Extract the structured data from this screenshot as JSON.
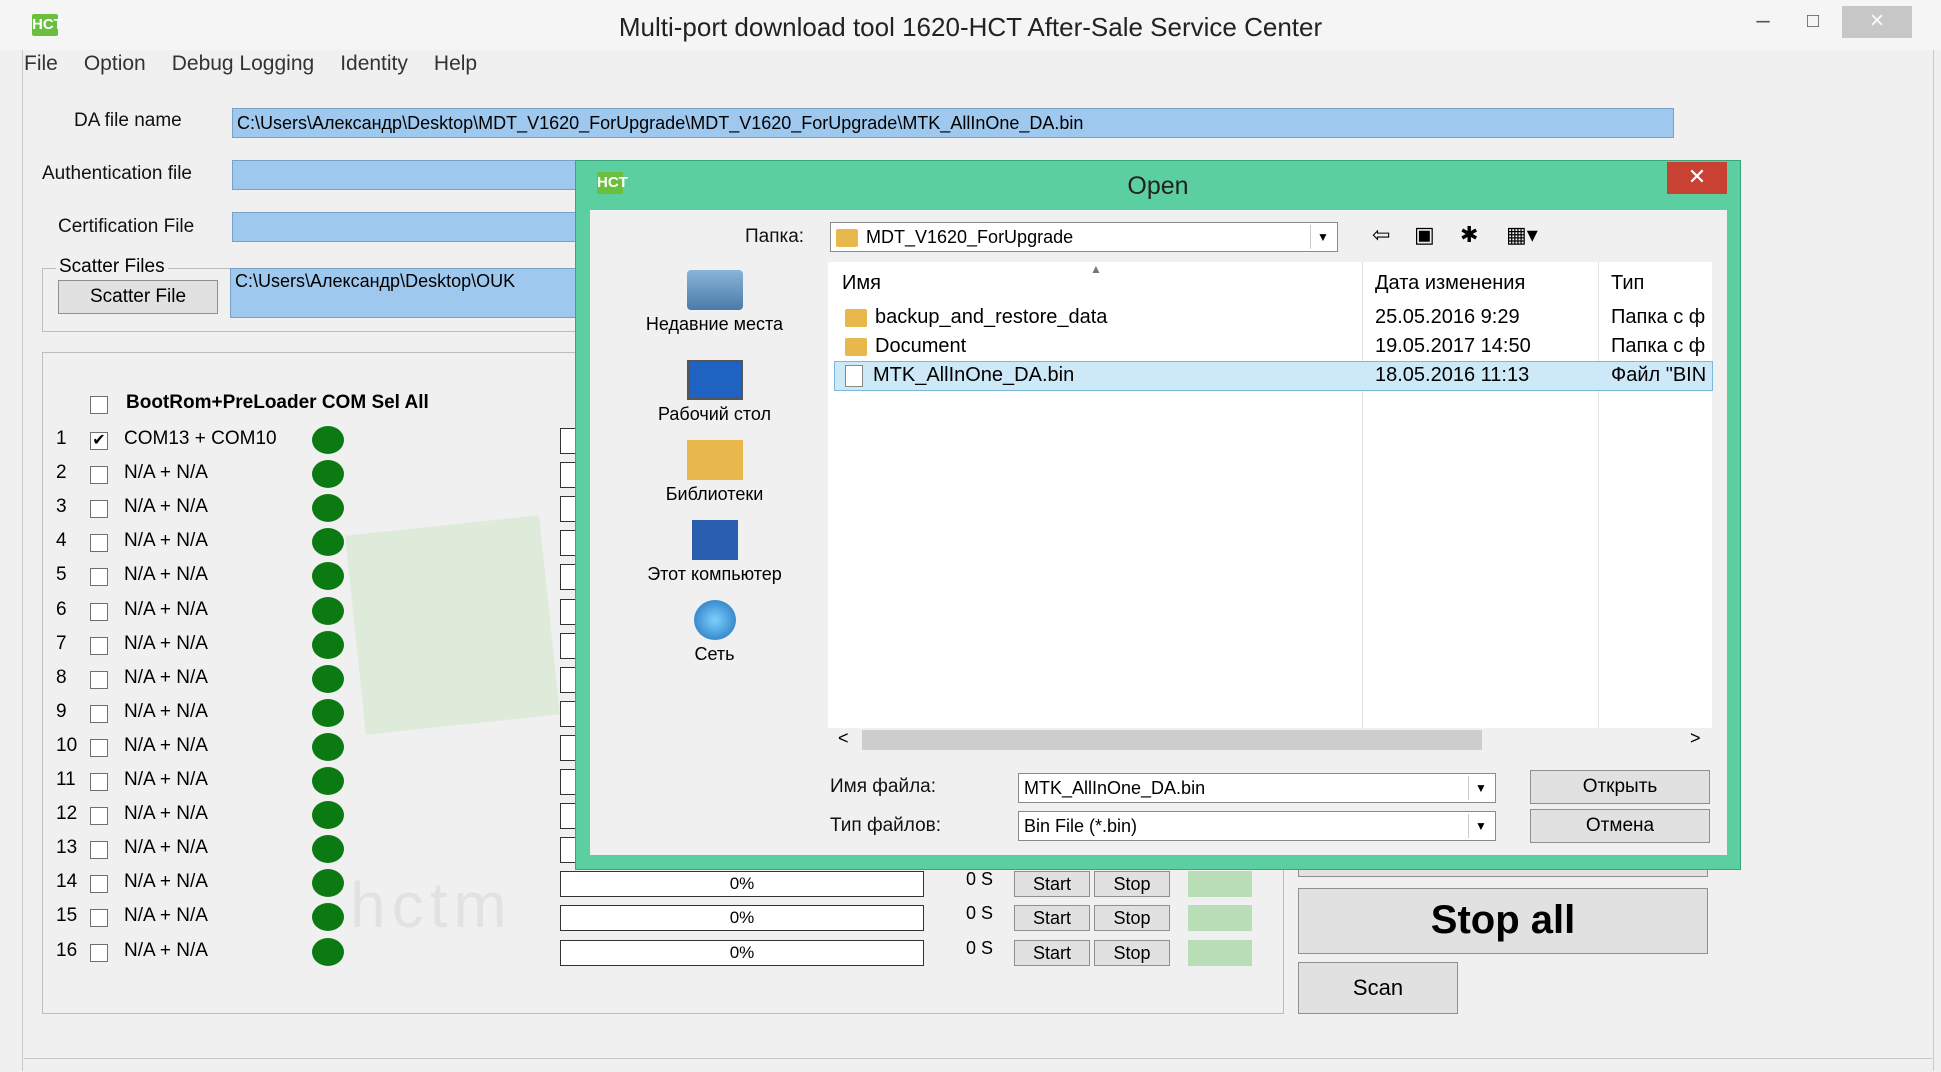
{
  "window": {
    "title": "Multi-port download tool 1620-HCT After-Sale Service Center",
    "icon_text": "HCT",
    "controls": [
      "–",
      "□",
      "×"
    ]
  },
  "menu": [
    "File",
    "Option",
    "Debug Logging",
    "Identity",
    "Help"
  ],
  "form": {
    "da_label": "DA file name",
    "da_value": "C:\\Users\\Александр\\Desktop\\MDT_V1620_ForUpgrade\\MDT_V1620_ForUpgrade\\MTK_AllInOne_DA.bin",
    "auth_label": "Authentication file",
    "auth_value": "",
    "cert_label": "Certification File",
    "cert_value": "",
    "scatter_group": "Scatter Files",
    "scatter_button": "Scatter File",
    "scatter_value": "C:\\Users\\Александр\\Desktop\\OUK"
  },
  "ports": {
    "select_all_label": "BootRom+PreLoader COM Sel All",
    "rows": [
      {
        "num": "1",
        "name": "COM13 + COM10",
        "checked": true
      },
      {
        "num": "2",
        "name": "N/A + N/A",
        "checked": false
      },
      {
        "num": "3",
        "name": "N/A + N/A",
        "checked": false
      },
      {
        "num": "4",
        "name": "N/A + N/A",
        "checked": false
      },
      {
        "num": "5",
        "name": "N/A + N/A",
        "checked": false
      },
      {
        "num": "6",
        "name": "N/A + N/A",
        "checked": false
      },
      {
        "num": "7",
        "name": "N/A + N/A",
        "checked": false
      },
      {
        "num": "8",
        "name": "N/A + N/A",
        "checked": false
      },
      {
        "num": "9",
        "name": "N/A + N/A",
        "checked": false
      },
      {
        "num": "10",
        "name": "N/A + N/A",
        "checked": false
      },
      {
        "num": "11",
        "name": "N/A + N/A",
        "checked": false
      },
      {
        "num": "12",
        "name": "N/A + N/A",
        "checked": false
      },
      {
        "num": "13",
        "name": "N/A + N/A",
        "checked": false
      },
      {
        "num": "14",
        "name": "N/A + N/A",
        "checked": false,
        "progress": "0%",
        "time": "0 S"
      },
      {
        "num": "15",
        "name": "N/A + N/A",
        "checked": false,
        "progress": "0%",
        "time": "0 S"
      },
      {
        "num": "16",
        "name": "N/A + N/A",
        "checked": false,
        "progress": "0%",
        "time": "0 S"
      }
    ],
    "start_label": "Start",
    "stop_label": "Stop",
    "watermark": "hctm"
  },
  "actions": {
    "stop_all": "Stop all",
    "scan": "Scan"
  },
  "dialog": {
    "title": "Open",
    "folder_label": "Папка:",
    "folder_value": "MDT_V1620_ForUpgrade",
    "places": [
      "Недавние места",
      "Рабочий стол",
      "Библиотеки",
      "Этот компьютер",
      "Сеть"
    ],
    "columns": [
      "Имя",
      "Дата изменения",
      "Тип"
    ],
    "files": [
      {
        "name": "backup_and_restore_data",
        "date": "25.05.2016 9:29",
        "type": "Папка с ф",
        "kind": "folder"
      },
      {
        "name": "Document",
        "date": "19.05.2017 14:50",
        "type": "Папка с ф",
        "kind": "folder"
      },
      {
        "name": "MTK_AllInOne_DA.bin",
        "date": "18.05.2016 11:13",
        "type": "Файл \"BIN",
        "kind": "file",
        "selected": true
      }
    ],
    "filename_label": "Имя файла:",
    "filename_value": "MTK_AllInOne_DA.bin",
    "filetype_label": "Тип файлов:",
    "filetype_value": "Bin File (*.bin)",
    "open_button": "Открыть",
    "cancel_button": "Отмена",
    "scroll_left": "<",
    "scroll_right": ">"
  }
}
